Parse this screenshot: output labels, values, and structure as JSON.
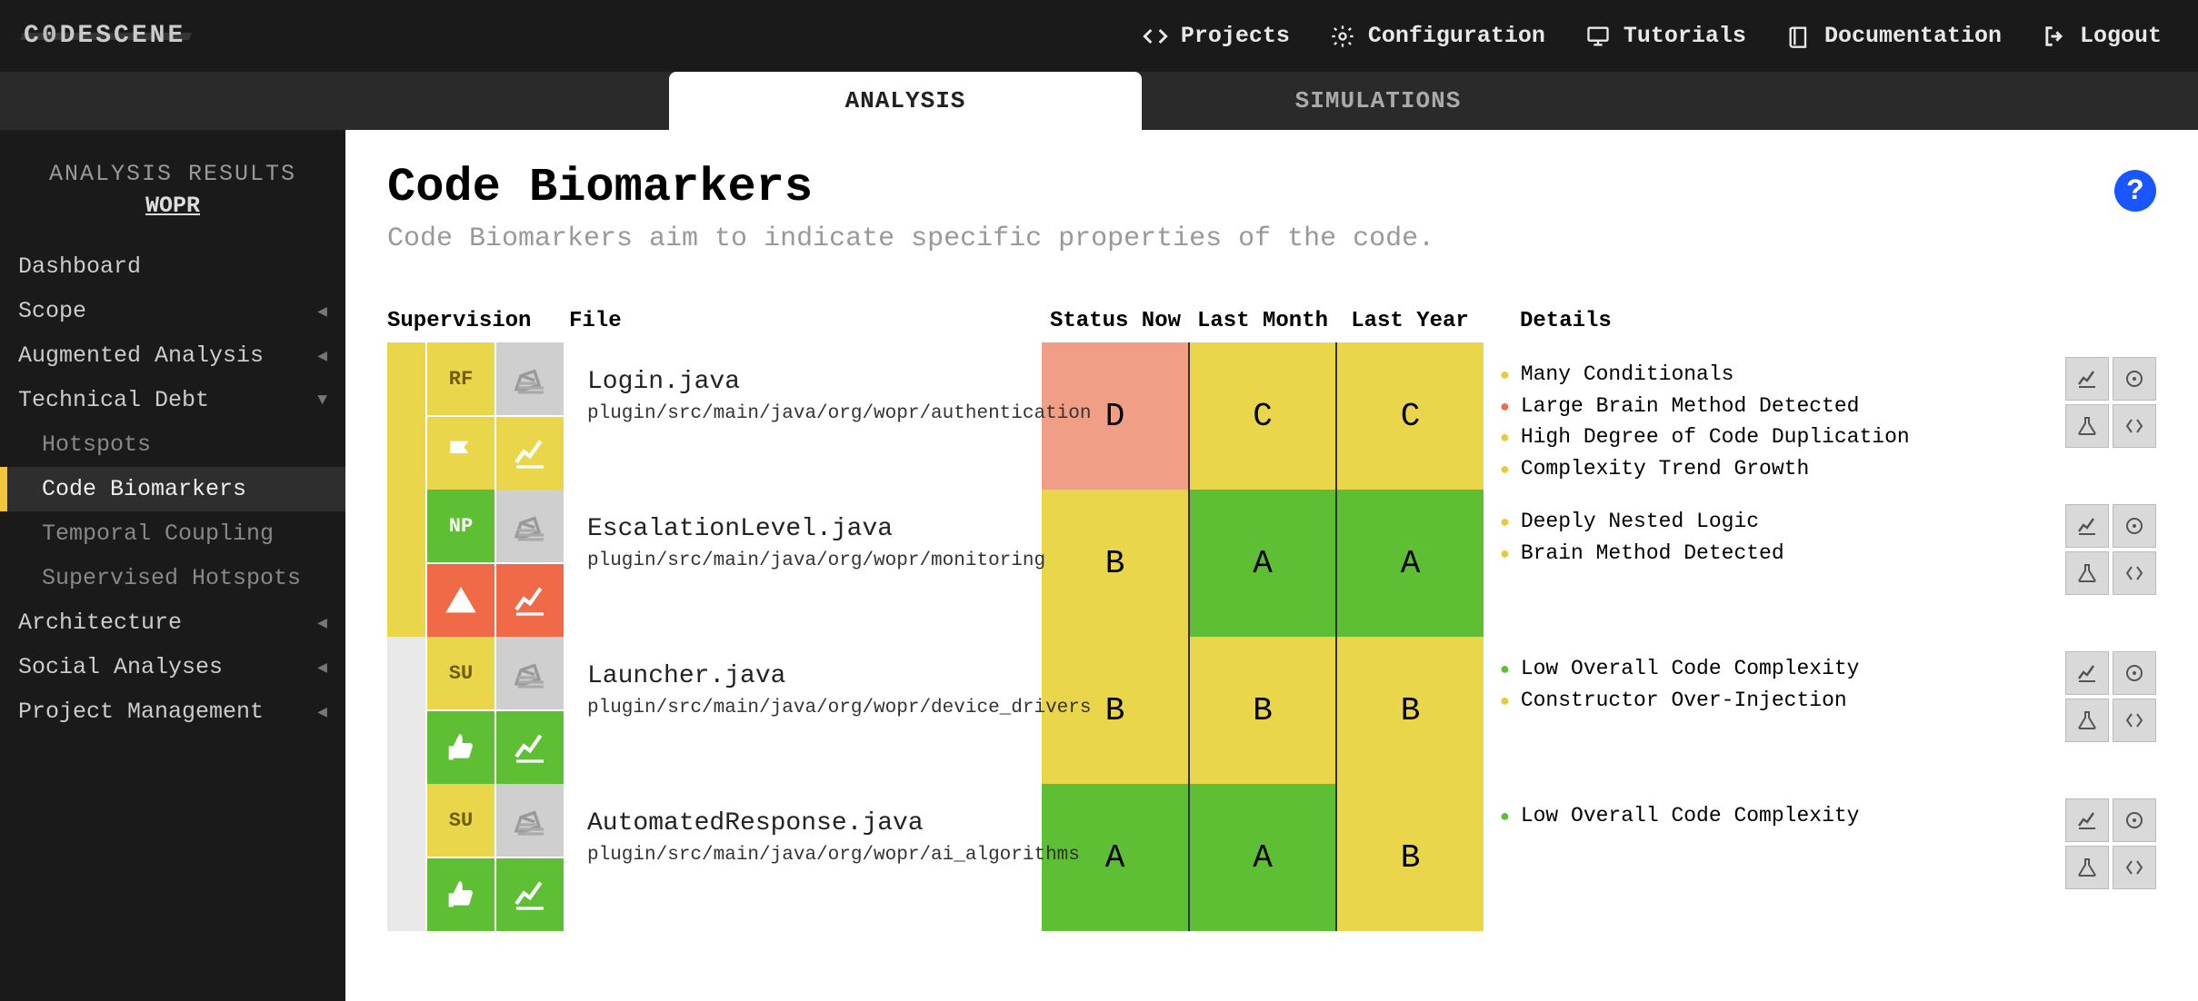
{
  "brand": "C0DESCENE",
  "topnav": [
    {
      "label": "Projects",
      "icon": "code"
    },
    {
      "label": "Configuration",
      "icon": "gear"
    },
    {
      "label": "Tutorials",
      "icon": "monitor"
    },
    {
      "label": "Documentation",
      "icon": "book"
    },
    {
      "label": "Logout",
      "icon": "logout"
    }
  ],
  "subtabs": {
    "active": "ANALYSIS",
    "other": "SIMULATIONS"
  },
  "sidebar": {
    "title": "ANALYSIS RESULTS",
    "project": "WOPR",
    "items": [
      "Dashboard",
      "Scope",
      "Augmented Analysis",
      "Technical Debt",
      "Architecture",
      "Social Analyses",
      "Project Management"
    ],
    "subs": [
      "Hotspots",
      "Code Biomarkers",
      "Temporal Coupling",
      "Supervised Hotspots"
    ],
    "active_sub": "Code Biomarkers",
    "expanded": "Technical Debt"
  },
  "page": {
    "title": "Code Biomarkers",
    "subtitle": "Code Biomarkers aim to indicate specific properties of the code."
  },
  "columns": {
    "supervision": "Supervision",
    "file": "File",
    "status_now": "Status Now",
    "last_month": "Last Month",
    "last_year": "Last Year",
    "details": "Details"
  },
  "rows": [
    {
      "badge": "RF",
      "badge_color": "yellow",
      "warn_icon": "flag",
      "warn_color": "yellow",
      "stripe": "yellow",
      "file": "Login.java",
      "path": "plugin/src/main/java/org/wopr/authentication",
      "now": "D",
      "month": "C",
      "year": "C",
      "details": [
        {
          "text": "Many Conditionals",
          "sev": "yellow"
        },
        {
          "text": "Large Brain Method Detected",
          "sev": "red"
        },
        {
          "text": "High Degree of Code Duplication",
          "sev": "yellow"
        },
        {
          "text": "Complexity Trend Growth",
          "sev": "yellow"
        }
      ]
    },
    {
      "badge": "NP",
      "badge_color": "green",
      "warn_icon": "alert",
      "warn_color": "red",
      "stripe": "yellow",
      "file": "EscalationLevel.java",
      "path": "plugin/src/main/java/org/wopr/monitoring",
      "now": "B",
      "month": "A",
      "year": "A",
      "details": [
        {
          "text": "Deeply Nested Logic",
          "sev": "yellow"
        },
        {
          "text": "Brain Method Detected",
          "sev": "yellow"
        }
      ]
    },
    {
      "badge": "SU",
      "badge_color": "yellow",
      "warn_icon": "thumb",
      "warn_color": "green",
      "stripe": "light",
      "file": "Launcher.java",
      "path": "plugin/src/main/java/org/wopr/device_drivers",
      "now": "B",
      "month": "B",
      "year": "B",
      "details": [
        {
          "text": "Low Overall Code Complexity",
          "sev": "green"
        },
        {
          "text": "Constructor Over-Injection",
          "sev": "yellow"
        }
      ]
    },
    {
      "badge": "SU",
      "badge_color": "yellow",
      "warn_icon": "thumb",
      "warn_color": "green",
      "stripe": "light",
      "file": "AutomatedResponse.java",
      "path": "plugin/src/main/java/org/wopr/ai_algorithms",
      "now": "A",
      "month": "A",
      "year": "B",
      "details": [
        {
          "text": "Low Overall Code Complexity",
          "sev": "green"
        }
      ]
    }
  ]
}
